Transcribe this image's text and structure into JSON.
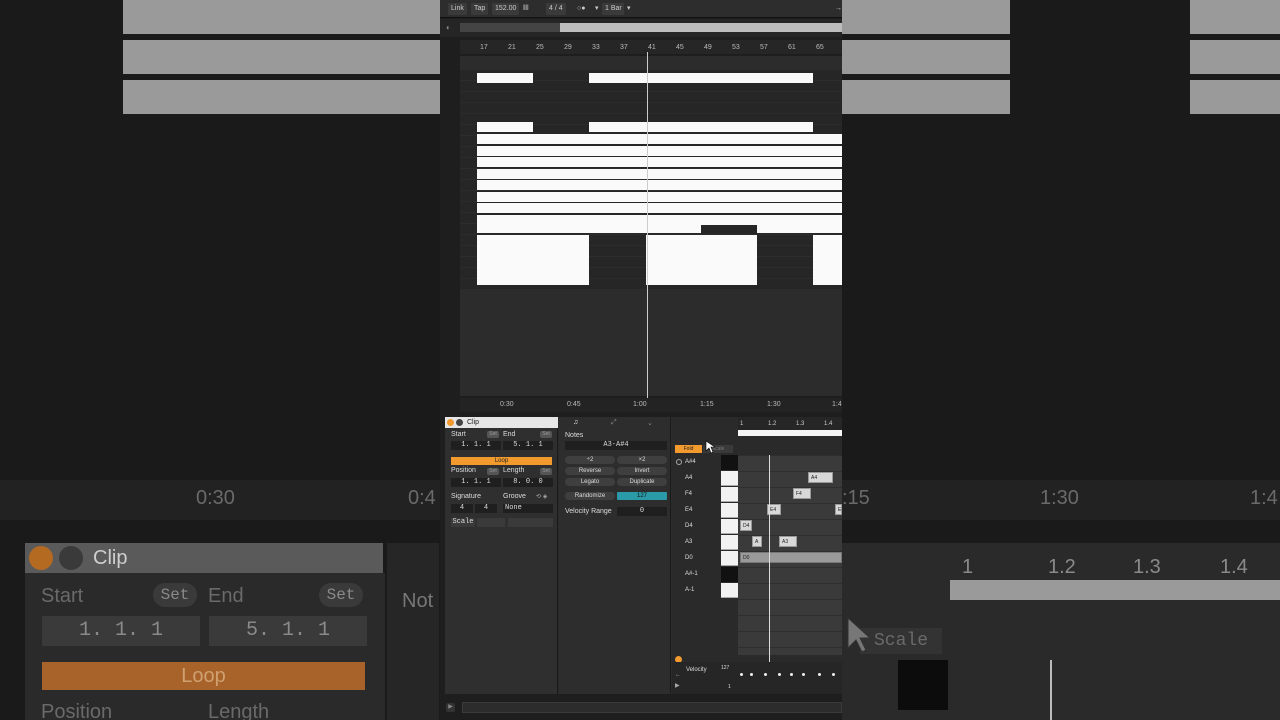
{
  "toolbar": {
    "link": "Link",
    "tap": "Tap",
    "tempo": "152.00",
    "signature": "4 / 4",
    "quantize": "1 Bar"
  },
  "ruler": {
    "bars": [
      "17",
      "21",
      "25",
      "29",
      "33",
      "37",
      "41",
      "45",
      "49",
      "53",
      "57",
      "61",
      "65"
    ]
  },
  "time_ruler": {
    "times": [
      "0:30",
      "0:45",
      "1:00",
      "1:15",
      "1:30",
      "1:4"
    ]
  },
  "background": {
    "clip_title": "Clip",
    "start": "Start",
    "end": "End",
    "set": "Set",
    "start_value": "1.   1.   1",
    "end_value": "5.   1.   1",
    "loop": "Loop",
    "position": "Position",
    "length": "Length",
    "notes_partial": "Not",
    "scale_partial": "Scale",
    "time_030": "0:30",
    "time_04": "0:4",
    "time_115": ":15",
    "time_130": "1:30",
    "time_14": "1:4",
    "beat_1": "1",
    "beat_12": "1.2",
    "beat_13": "1.3",
    "beat_14": "1.4"
  },
  "clip": {
    "title": "Clip",
    "start_label": "Start",
    "end_label": "End",
    "set": "Set",
    "start_value": "1.   1.   1",
    "end_value": "5.   1.   1",
    "loop_label": "Loop",
    "position_label": "Position",
    "length_label": "Length",
    "position_value": "1.   1.   1",
    "length_value": "8.   0.   0",
    "signature_label": "Signature",
    "groove_label": "Groove",
    "sig_num": "4",
    "sig_den": "4",
    "groove_value": "None",
    "scale_label": "Scale"
  },
  "notes_panel": {
    "title": "Notes",
    "range": "A3-A#4",
    "half": "÷2",
    "double": "×2",
    "reverse": "Reverse",
    "invert": "Invert",
    "legato": "Legato",
    "duplicate": "Duplicate",
    "randomize": "Randomize",
    "randomize_value": "127",
    "velocity_range": "Velocity Range",
    "velocity_range_value": "0"
  },
  "piano": {
    "fold": "Fold",
    "scale": "Scale",
    "beats": [
      "1",
      "1.2",
      "1.3",
      "1.4"
    ],
    "keys": [
      "A#4",
      "A4",
      "F4",
      "E4",
      "D4",
      "A3",
      "D0",
      "A#-1",
      "A-1"
    ],
    "notes": [
      {
        "label": "A4"
      },
      {
        "label": "F4"
      },
      {
        "label": "E4"
      },
      {
        "label": "E"
      },
      {
        "label": "D4"
      },
      {
        "label": "A"
      },
      {
        "label": "A3"
      },
      {
        "label": "D0"
      }
    ],
    "velocity_label": "Velocity",
    "velocity_max": "127",
    "velocity_min": "1"
  }
}
